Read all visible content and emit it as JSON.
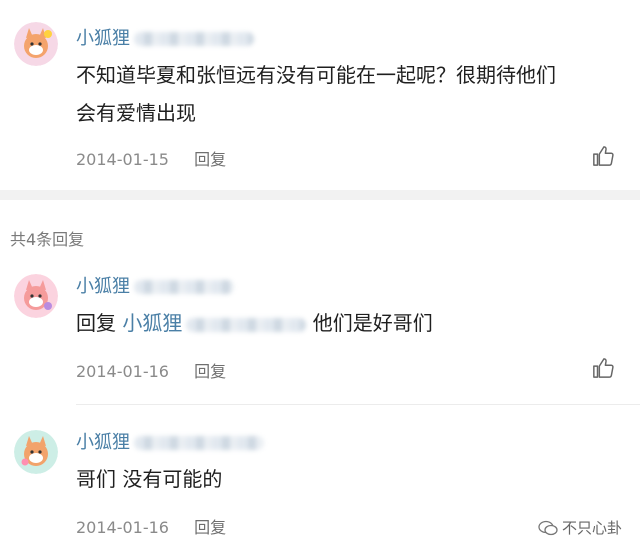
{
  "main_comment": {
    "username": "小狐狸",
    "text_line1": "不知道毕夏和张恒远有没有可能在一起呢？很期待他们",
    "text_line2": "会有爱情出现",
    "date": "2014-01-15",
    "reply_label": "回复"
  },
  "replies_header": "共4条回复",
  "replies": [
    {
      "username": "小狐狸",
      "prefix": "回复",
      "mention": "小狐狸",
      "text": "他们是好哥们",
      "date": "2014-01-16",
      "reply_label": "回复"
    },
    {
      "username": "小狐狸",
      "text": "哥们 没有可能的",
      "date": "2014-01-16",
      "reply_label": "回复"
    }
  ],
  "watermark": "不只心卦",
  "colors": {
    "username": "#4a7fa6",
    "meta": "#8a8a8a",
    "divider": "#f2f2f2"
  }
}
